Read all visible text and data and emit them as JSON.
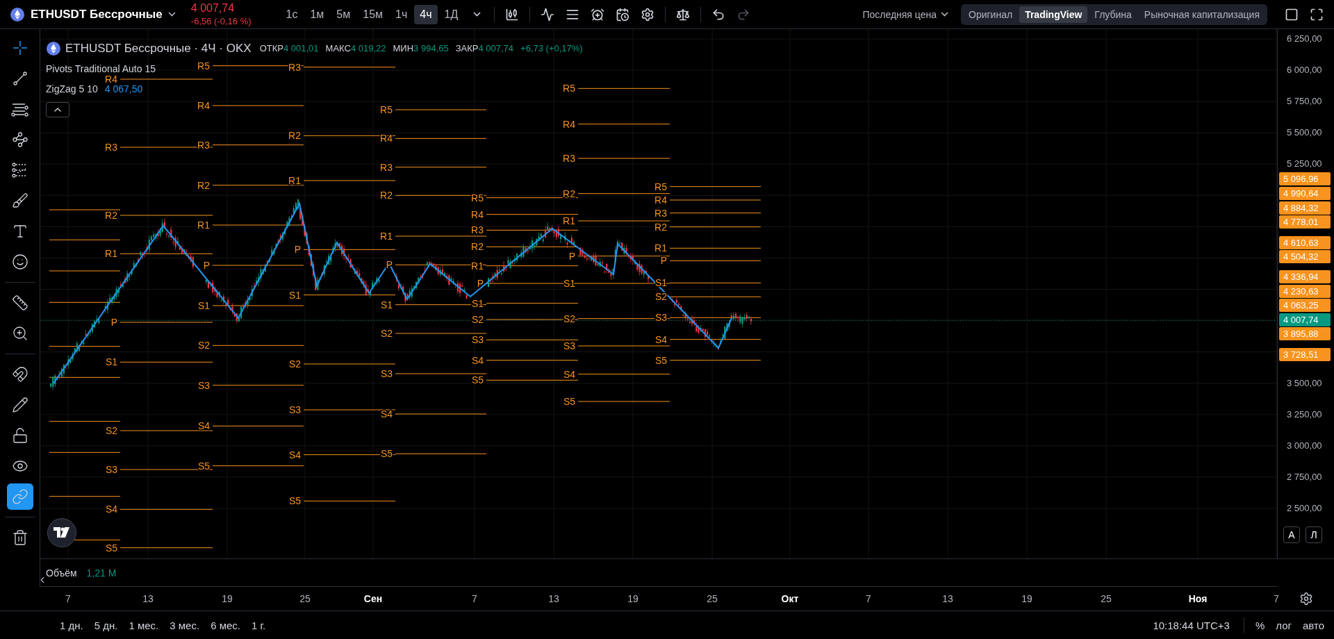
{
  "header": {
    "symbol": "ETHUSDT Бессрочные",
    "price": "4 007,74",
    "change": "-6,56 (-0,16 %)",
    "intervals": [
      {
        "label": "1с",
        "selected": false
      },
      {
        "label": "1м",
        "selected": false
      },
      {
        "label": "5м",
        "selected": false
      },
      {
        "label": "15м",
        "selected": false
      },
      {
        "label": "1ч",
        "selected": false
      },
      {
        "label": "4ч",
        "selected": true
      },
      {
        "label": "1Д",
        "selected": false
      }
    ],
    "history": [
      {
        "kind": "undo",
        "disabled": false
      },
      {
        "kind": "redo",
        "disabled": true
      }
    ],
    "price_source": "Последняя цена",
    "chart_types": [
      {
        "label": "Оригинал",
        "selected": false
      },
      {
        "label": "TradingView",
        "selected": true
      },
      {
        "label": "Глубина",
        "selected": false
      },
      {
        "label": "Рыночная капитализация",
        "selected": false
      }
    ]
  },
  "toolbar": {
    "groups": [
      {
        "tools": [
          {
            "kind": "crosshair",
            "selected": true
          },
          {
            "kind": "trend-line",
            "selected": false
          },
          {
            "kind": "fib",
            "selected": false
          },
          {
            "kind": "pattern",
            "selected": false
          },
          {
            "kind": "forecast",
            "selected": false
          },
          {
            "kind": "brush",
            "selected": false
          },
          {
            "kind": "text",
            "selected": false
          },
          {
            "kind": "emoji",
            "selected": false
          }
        ]
      },
      {
        "tools": [
          {
            "kind": "ruler",
            "selected": false
          },
          {
            "kind": "zoom",
            "selected": false
          }
        ]
      },
      {
        "tools": [
          {
            "kind": "magnet",
            "selected": false,
            "on": false
          },
          {
            "kind": "drawing-lock",
            "selected": false,
            "on": false
          },
          {
            "kind": "lock",
            "selected": false,
            "on": false
          },
          {
            "kind": "visibility",
            "selected": false,
            "on": false
          },
          {
            "kind": "link",
            "selected": false,
            "on": true
          }
        ]
      },
      {
        "tools": [
          {
            "kind": "trash",
            "selected": false
          }
        ]
      }
    ]
  },
  "legend": {
    "title": "ETHUSDT Бессрочные · 4Ч · OKX",
    "ohlc": [
      {
        "label": "ОТКР",
        "value": "4 001,01"
      },
      {
        "label": "МАКС",
        "value": "4 019,22"
      },
      {
        "label": "МИН",
        "value": "3 994,65"
      },
      {
        "label": "ЗАКР",
        "value": "4 007,74"
      }
    ],
    "change": "+6,73 (+0,17%)",
    "indicators": [
      {
        "name": "Pivots Traditional Auto 15"
      },
      {
        "name": "ZigZag 5 10",
        "value": "4 067,50"
      }
    ]
  },
  "pivots": [
    {
      "labels": [
        "R4",
        "R3",
        "R2",
        "R1",
        "P",
        "S1",
        "S2",
        "S3",
        "S4",
        "S5"
      ]
    },
    {
      "labels": [
        "R5",
        "R4",
        "R3",
        "R2",
        "R1",
        "P",
        "S1",
        "S2",
        "S3",
        "S4",
        "S5"
      ]
    },
    {
      "labels": [
        "R3",
        "R2",
        "R1",
        "P",
        "S1",
        "S2",
        "S3",
        "S4",
        "S5"
      ]
    },
    {
      "labels": [
        "R5",
        "R4",
        "R3",
        "R2",
        "R1",
        "P",
        "S1",
        "S2",
        "S3",
        "S4",
        "S5"
      ]
    },
    {
      "labels": [
        "R5",
        "R4",
        "R3",
        "R2",
        "R1",
        "P",
        "S1",
        "S2",
        "S3",
        "S4",
        "S5"
      ]
    },
    {
      "labels": [
        "R5",
        "R4",
        "R3",
        "R2",
        "R1",
        "P",
        "S1",
        "S2",
        "S3",
        "S4",
        "S5"
      ]
    },
    {
      "labels": [
        "R5",
        "R4",
        "R3",
        "R2",
        "R1",
        "P",
        "S1",
        "S2",
        "S3",
        "S4",
        "S5"
      ]
    }
  ],
  "price_axis": {
    "ticks": [
      "6 250,00",
      "6 000,00",
      "5 750,00",
      "5 500,00",
      "5 250,00",
      "3 500,00",
      "3 250,00",
      "3 000,00",
      "2 750,00",
      "2 500,00"
    ],
    "markers": [
      {
        "text": "5 096,96",
        "kind": "pivot"
      },
      {
        "text": "4 990,64",
        "kind": "pivot"
      },
      {
        "text": "4 884,32",
        "kind": "pivot"
      },
      {
        "text": "4 778,01",
        "kind": "pivot"
      },
      {
        "text": "4 610,63",
        "kind": "pivot"
      },
      {
        "text": "4 504,32",
        "kind": "pivot"
      },
      {
        "text": "4 336,94",
        "kind": "pivot"
      },
      {
        "text": "4 230,63",
        "kind": "pivot"
      },
      {
        "text": "4 063,25",
        "kind": "pivot"
      },
      {
        "text": "4 007,74",
        "kind": "last"
      },
      {
        "text": "3 895,88",
        "kind": "pivot"
      },
      {
        "text": "3 728,51",
        "kind": "pivot"
      }
    ],
    "scale_buttons": [
      "А",
      "Л"
    ]
  },
  "volume": {
    "label": "Объём",
    "value": "1,21 M"
  },
  "time_axis": {
    "labels": [
      {
        "text": "7",
        "kind": "day"
      },
      {
        "text": "13",
        "kind": "day"
      },
      {
        "text": "19",
        "kind": "day"
      },
      {
        "text": "25",
        "kind": "day"
      },
      {
        "text": "Сен",
        "kind": "month"
      },
      {
        "text": "7",
        "kind": "day"
      },
      {
        "text": "13",
        "kind": "day"
      },
      {
        "text": "19",
        "kind": "day"
      },
      {
        "text": "25",
        "kind": "day"
      },
      {
        "text": "Окт",
        "kind": "month"
      },
      {
        "text": "7",
        "kind": "day"
      },
      {
        "text": "13",
        "kind": "day"
      },
      {
        "text": "19",
        "kind": "day"
      },
      {
        "text": "25",
        "kind": "day"
      },
      {
        "text": "Ноя",
        "kind": "month"
      },
      {
        "text": "7",
        "kind": "day"
      }
    ]
  },
  "ranges": [
    "1 дн.",
    "5 дн.",
    "1 мес.",
    "3 мес.",
    "6 мес.",
    "1 г."
  ],
  "status": {
    "time": "10:18:44 UTC+3",
    "options": [
      "%",
      "лог",
      "авто"
    ]
  }
}
